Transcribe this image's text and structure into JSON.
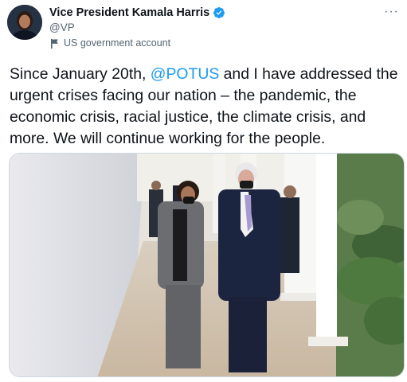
{
  "author": {
    "display_name": "Vice President Kamala Harris",
    "handle": "@VP",
    "account_label": "US government account",
    "avatar_icon": "avatar-photo",
    "verified_icon": "verified-badge-icon",
    "label_icon": "flag-icon"
  },
  "menu_icon": "more-options-icon",
  "tweet": {
    "text_before": "Since January 20th, ",
    "mention": "@POTUS",
    "text_after": " and I have addressed the urgent crises facing our nation – the pandemic, the economic crisis, racial justice, the climate crisis, and more. We will continue working for the people."
  },
  "media": {
    "type": "photo"
  },
  "colors": {
    "text": "#0f1419",
    "secondary": "#536471",
    "link": "#1d9bf0",
    "verified": "#1d9bf0"
  }
}
